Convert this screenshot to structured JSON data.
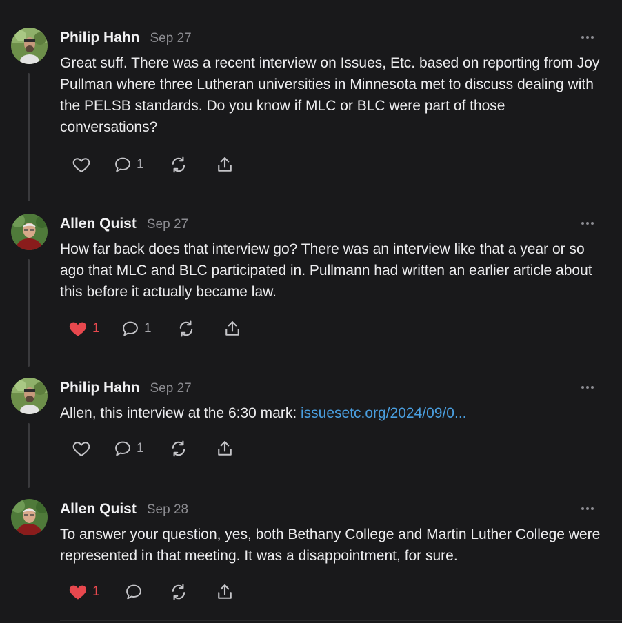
{
  "comments": [
    {
      "author": "Philip Hahn",
      "date": "Sep 27",
      "text_before_link": "Great suff. There was a recent interview on Issues, Etc. based on reporting from Joy Pullman where three Lutheran universities in Minnesota met to discuss dealing with the PELSB standards. Do you know if MLC or BLC were part of those conversations?",
      "link_text": "",
      "likes": "",
      "liked": false,
      "replies": "1"
    },
    {
      "author": "Allen Quist",
      "date": "Sep 27",
      "text_before_link": "How far back does that interview go? There was an interview like that a year or so ago that MLC and BLC participated in. Pullmann had written an earlier article about this before it actually became law.",
      "link_text": "",
      "likes": "1",
      "liked": true,
      "replies": "1"
    },
    {
      "author": "Philip Hahn",
      "date": "Sep 27",
      "text_before_link": "Allen, this interview at the 6:30 mark: ",
      "link_text": "issuesetc.org/2024/09/0...",
      "likes": "",
      "liked": false,
      "replies": "1"
    },
    {
      "author": "Allen Quist",
      "date": "Sep 28",
      "text_before_link": "To answer your question, yes, both Bethany College and Martin Luther College were represented in that meeting. It was a disappointment, for sure.",
      "link_text": "",
      "likes": "1",
      "liked": true,
      "replies": ""
    }
  ],
  "icons": {
    "like": "heart-icon",
    "reply": "comment-bubble-icon",
    "restack": "restack-icon",
    "share": "share-icon",
    "more": "more-dots-icon"
  },
  "colors": {
    "background": "#19191b",
    "text": "#ececee",
    "muted": "#8b8b90",
    "link": "#4a9fe0",
    "liked": "#e8484e"
  }
}
